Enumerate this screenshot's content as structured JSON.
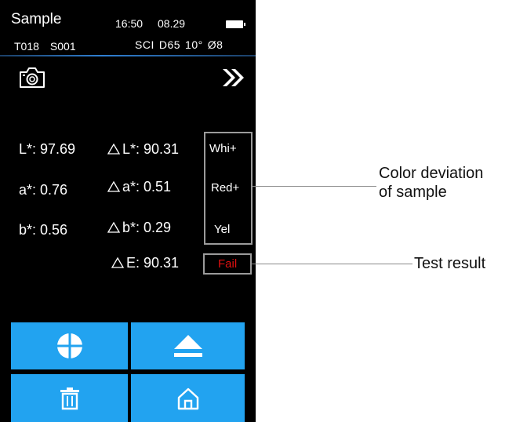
{
  "header": {
    "title": "Sample",
    "time": "16:50",
    "date": "08.29",
    "test_id": "T018",
    "sample_id": "S001",
    "mode": "SCI",
    "illuminant": "D65",
    "observer": "10°",
    "aperture": "Ø8"
  },
  "icons": {
    "camera": "camera-icon",
    "next": "double-chevron-right-icon",
    "locate": "crosshair-circle-icon",
    "eject": "eject-icon",
    "delete": "trash-icon",
    "home": "home-icon",
    "battery": "battery-icon"
  },
  "measurements": [
    {
      "label": "L*: 97.69",
      "delta": "L*: 90.31",
      "deviation": "Whi+"
    },
    {
      "label": "a*: 0.76",
      "delta": "a*: 0.51",
      "deviation": "Red+"
    },
    {
      "label": "b*: 0.56",
      "delta": "b*: 0.29",
      "deviation": "Yel"
    }
  ],
  "delta_e": "E: 90.31",
  "result": "Fail",
  "colors": {
    "accent": "#22a3f0",
    "fail": "#e01010",
    "background": "#000000"
  },
  "annotations": {
    "color_deviation_line1": "Color deviation",
    "color_deviation_line2": "of sample",
    "test_result": "Test result"
  }
}
